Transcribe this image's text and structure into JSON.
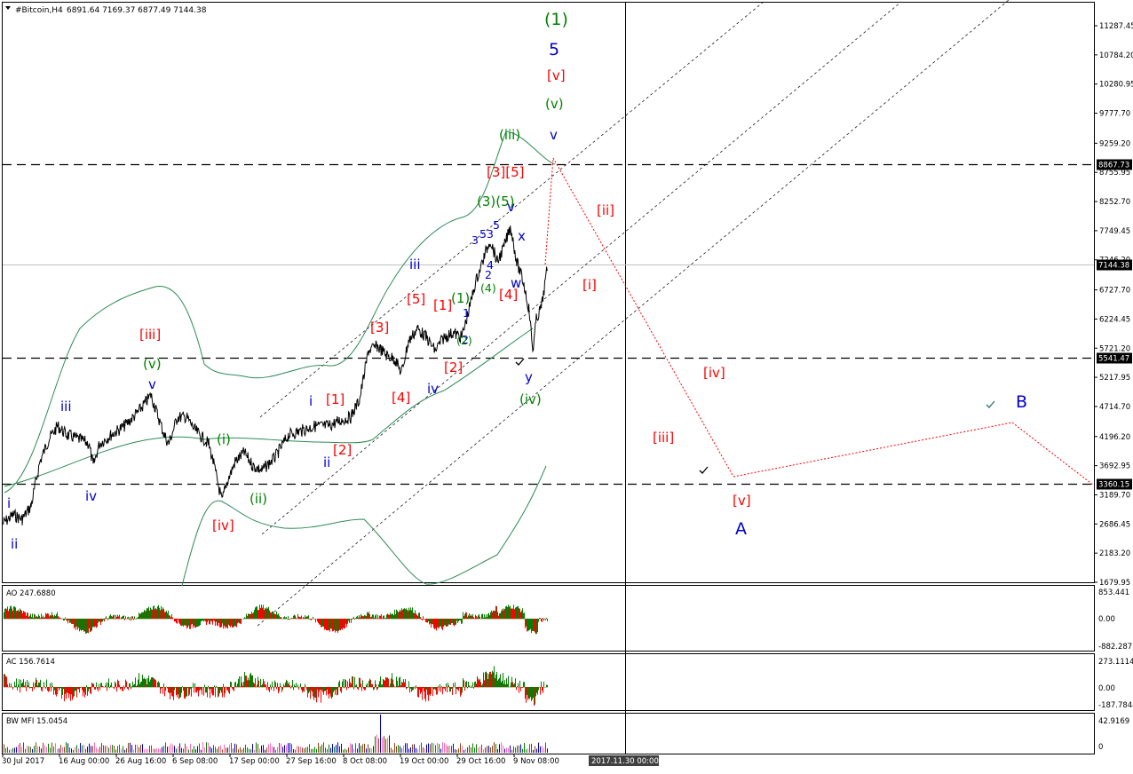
{
  "colors": {
    "bull": "#008000",
    "bear": "#ff0000",
    "blue": "#0000cd",
    "green": "#008000",
    "red": "#ff0000",
    "band": "#2e8b57",
    "grid": "#000000"
  },
  "header": {
    "symbol_label": "#Bitcoin,H4",
    "ohlc": "6891.64 7169.37 6877.49 7144.38"
  },
  "price_axis": {
    "ticks": [
      "11287.45",
      "10784.20",
      "10280.95",
      "9777.70",
      "9259.20",
      "8755.95",
      "8252.70",
      "7749.45",
      "7246.20",
      "6727.70",
      "6224.45",
      "5721.20",
      "5217.95",
      "4714.70",
      "4196.20",
      "3692.95",
      "3189.70",
      "2686.45",
      "2183.20",
      "1679.95"
    ],
    "tick_values": [
      11287.45,
      10784.2,
      10280.95,
      9777.7,
      9259.2,
      8755.95,
      8252.7,
      7749.45,
      7246.2,
      6727.7,
      6224.45,
      5721.2,
      5217.95,
      4714.7,
      4196.2,
      3692.95,
      3189.7,
      2686.45,
      2183.2,
      1679.95
    ],
    "level_labels": [
      {
        "text": "8867.73",
        "value": 8867.73
      },
      {
        "text": "7144.38",
        "value": 7144.38
      },
      {
        "text": "5541.47",
        "value": 5541.47
      },
      {
        "text": "3360.15",
        "value": 3360.15
      }
    ]
  },
  "time_axis": {
    "labels": [
      "30 Jul 2017",
      "16 Aug 00:00",
      "26 Aug 16:00",
      "6 Sep 08:00",
      "17 Sep 00:00",
      "27 Sep 16:00",
      "8 Oct 08:00",
      "19 Oct 00:00",
      "29 Oct 16:00",
      "9 Nov 08:00"
    ],
    "highlight": "2017.11.30 00:00"
  },
  "indicators": {
    "ao": {
      "label": "AO 247.6880",
      "ticks": [
        "853.441",
        "0.00",
        "-882.287"
      ]
    },
    "ac": {
      "label": "AC 156.7614",
      "ticks": [
        "273.1114",
        "0.00",
        "-187.7844"
      ]
    },
    "mfi": {
      "label": "BW MFI 15.0454",
      "ticks": [
        "42.9169",
        "0"
      ]
    }
  },
  "wave_labels": [
    {
      "text": "(1)",
      "color": "green",
      "size": "big"
    },
    {
      "text": "5",
      "color": "blue",
      "size": "big"
    },
    {
      "text": "[v]",
      "color": "red",
      "size": "mid"
    },
    {
      "text": "(v)",
      "color": "green",
      "size": "mid"
    },
    {
      "text": "v",
      "color": "blue",
      "size": "mid"
    },
    {
      "text": "(iii)",
      "color": "green",
      "size": "mid"
    },
    {
      "text": "[3][5]",
      "color": "red",
      "size": "mid"
    },
    {
      "text": "(3)(5)",
      "color": "green",
      "size": "mid"
    },
    {
      "text": "v",
      "color": "blue",
      "size": "mid"
    },
    {
      "text": "3",
      "color": "blue",
      "size": "small"
    },
    {
      "text": "53",
      "color": "blue",
      "size": "small"
    },
    {
      "text": "5",
      "color": "blue",
      "size": "small"
    },
    {
      "text": "x",
      "color": "blue",
      "size": "mid"
    },
    {
      "text": "[ii]",
      "color": "red",
      "size": "mid"
    },
    {
      "text": "(4)",
      "color": "green",
      "size": "small"
    },
    {
      "text": "4",
      "color": "blue",
      "size": "small"
    },
    {
      "text": "2",
      "color": "blue",
      "size": "small"
    },
    {
      "text": "w",
      "color": "blue",
      "size": "mid"
    },
    {
      "text": "[4]",
      "color": "red",
      "size": "mid"
    },
    {
      "text": "[i]",
      "color": "red",
      "size": "mid"
    },
    {
      "text": "iii",
      "color": "blue",
      "size": "mid"
    },
    {
      "text": "[5]",
      "color": "red",
      "size": "mid"
    },
    {
      "text": "[1]",
      "color": "red",
      "size": "mid"
    },
    {
      "text": "(1)",
      "color": "green",
      "size": "mid"
    },
    {
      "text": "1",
      "color": "blue",
      "size": "small"
    },
    {
      "text": "2",
      "color": "blue",
      "size": "small"
    },
    {
      "text": "(2)",
      "color": "green",
      "size": "small"
    },
    {
      "text": "[3]",
      "color": "red",
      "size": "mid"
    },
    {
      "text": "[2]",
      "color": "red",
      "size": "mid"
    },
    {
      "text": "[4]",
      "color": "red",
      "size": "mid"
    },
    {
      "text": "iv",
      "color": "blue",
      "size": "mid"
    },
    {
      "text": "y",
      "color": "blue",
      "size": "mid"
    },
    {
      "text": "(iv)",
      "color": "green",
      "size": "mid"
    },
    {
      "text": "i",
      "color": "blue",
      "size": "mid"
    },
    {
      "text": "[1]",
      "color": "red",
      "size": "mid"
    },
    {
      "text": "[2]",
      "color": "red",
      "size": "mid"
    },
    {
      "text": "ii",
      "color": "blue",
      "size": "mid"
    },
    {
      "text": "[iii]",
      "color": "red",
      "size": "mid"
    },
    {
      "text": "(v)",
      "color": "green",
      "size": "mid"
    },
    {
      "text": "v",
      "color": "blue",
      "size": "mid"
    },
    {
      "text": "iii",
      "color": "blue",
      "size": "mid"
    },
    {
      "text": "iv",
      "color": "blue",
      "size": "mid"
    },
    {
      "text": "i",
      "color": "blue",
      "size": "mid"
    },
    {
      "text": "ii",
      "color": "blue",
      "size": "mid"
    },
    {
      "text": "(i)",
      "color": "green",
      "size": "mid"
    },
    {
      "text": "(ii)",
      "color": "green",
      "size": "mid"
    },
    {
      "text": "[iv]",
      "color": "red",
      "size": "mid"
    },
    {
      "text": "[iv]",
      "color": "red",
      "size": "mid"
    },
    {
      "text": "[iii]",
      "color": "red",
      "size": "mid"
    },
    {
      "text": "[v]",
      "color": "red",
      "size": "mid"
    },
    {
      "text": "A",
      "color": "blue",
      "size": "big"
    },
    {
      "text": "B",
      "color": "blue",
      "size": "big"
    }
  ]
}
